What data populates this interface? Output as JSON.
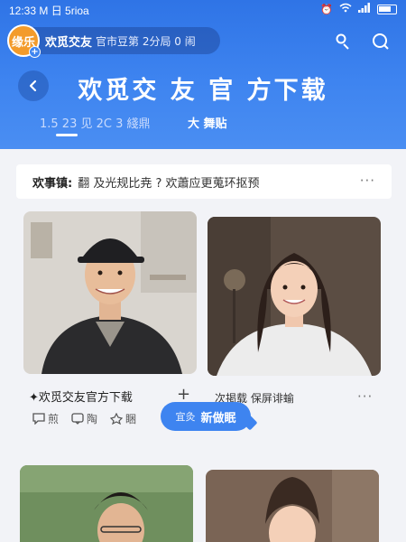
{
  "status": {
    "time": "12:33",
    "carrier": "M 日 5rioa",
    "icons": [
      "alarm-icon",
      "wifi-icon",
      "signal-icon",
      "battery-icon"
    ]
  },
  "appbar": {
    "avatar_text": "缘乐",
    "title": "欢觅交友",
    "subtitle": "官市豆第 2分局  0 闹"
  },
  "header": {
    "page_title": "欢觅交 友 官 方下载",
    "tab_left": "1.5 23  见 2C  3 綫鼎",
    "tab_right": "大  舞贴"
  },
  "notice": {
    "label": "欢事镇:",
    "text": "翻 及光规比尭 ? 欢蕭应更蒐环抠预",
    "more": "···"
  },
  "card1": {
    "caption": "✦欢觅交友官方下载",
    "actions": [
      {
        "icon": "comment-icon",
        "label": "煎"
      },
      {
        "icon": "message-icon",
        "label": "陶"
      },
      {
        "icon": "share-icon",
        "label": "睏"
      }
    ]
  },
  "card2": {
    "plus": "+",
    "caption": "次掲载 保屏诽蝓",
    "more": "···"
  },
  "bubble": {
    "hint": "宜灸",
    "main": "新做眠"
  },
  "colors": {
    "header_blue": "#3e84f0",
    "accent": "#2f74e6",
    "avatar_orange": "#f39b2b"
  }
}
